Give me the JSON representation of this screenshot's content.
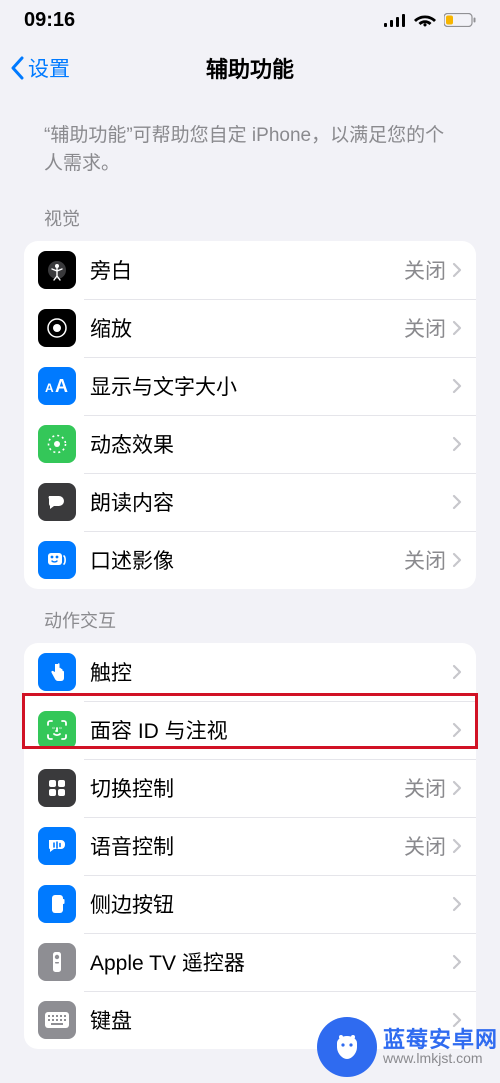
{
  "status": {
    "time": "09:16"
  },
  "nav": {
    "back_label": "设置",
    "title": "辅助功能"
  },
  "intro": "“辅助功能”可帮助您自定 iPhone，以满足您的个人需求。",
  "section_vision": {
    "header": "视觉",
    "items": [
      {
        "label": "旁白",
        "value": "关闭"
      },
      {
        "label": "缩放",
        "value": "关闭"
      },
      {
        "label": "显示与文字大小",
        "value": ""
      },
      {
        "label": "动态效果",
        "value": ""
      },
      {
        "label": "朗读内容",
        "value": ""
      },
      {
        "label": "口述影像",
        "value": "关闭"
      }
    ]
  },
  "section_motor": {
    "header": "动作交互",
    "items": [
      {
        "label": "触控",
        "value": ""
      },
      {
        "label": "面容 ID 与注视",
        "value": ""
      },
      {
        "label": "切换控制",
        "value": "关闭"
      },
      {
        "label": "语音控制",
        "value": "关闭"
      },
      {
        "label": "侧边按钮",
        "value": ""
      },
      {
        "label": "Apple TV 遥控器",
        "value": ""
      },
      {
        "label": "键盘",
        "value": ""
      }
    ]
  },
  "watermark": {
    "brand": "蓝莓安卓网",
    "url": "www.lmkjst.com"
  },
  "colors": {
    "link": "#007aff",
    "secondary": "#8a8a8e",
    "highlight_border": "#d11225",
    "icon_blue": "#007aff",
    "icon_green": "#34c759",
    "icon_gray": "#8e8e93",
    "icon_darkgray": "#3a3a3c"
  }
}
